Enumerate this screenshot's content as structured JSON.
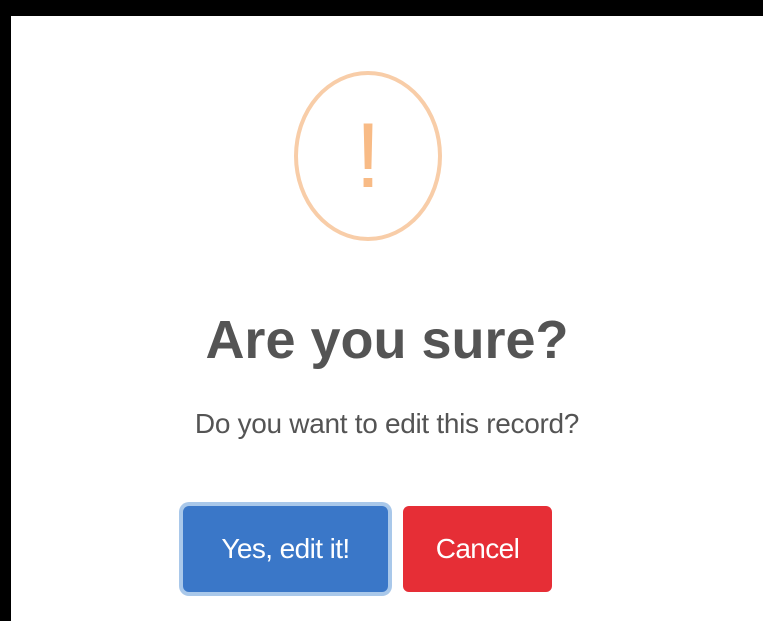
{
  "dialog": {
    "icon": {
      "name": "warning-icon",
      "glyph": "!",
      "ring_color": "#f8cda8",
      "glyph_color": "#f8bb86"
    },
    "title": "Are you sure?",
    "message": "Do you want to edit this record?",
    "buttons": {
      "confirm_label": "Yes, edit it!",
      "confirm_color": "#3a77c8",
      "cancel_label": "Cancel",
      "cancel_color": "#e62e36"
    }
  }
}
